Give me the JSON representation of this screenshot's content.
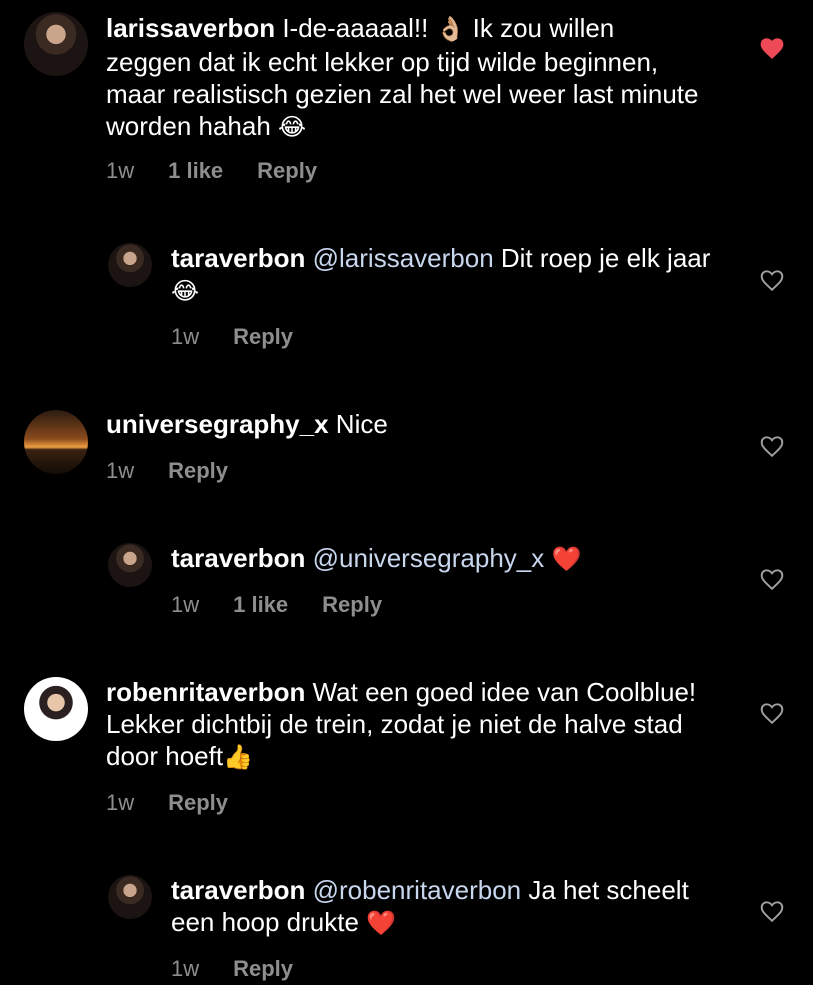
{
  "comments": [
    {
      "username": "larissaverbon",
      "text_before": " I-de-aaaaal!! ",
      "emoji1": "👌🏼",
      "text_after": " Ik zou willen zeggen dat ik echt lekker op tijd wilde beginnen, maar realistisch gezien zal het wel weer last minute worden hahah ",
      "emoji2": "😂",
      "time": "1w",
      "likes": "1 like",
      "reply": "Reply",
      "heart_color": "#ed4956"
    },
    {
      "username": "taraverbon",
      "mention": "@larissaverbon",
      "text": " Dit roep je elk jaar ",
      "emoji": "😂",
      "time": "1w",
      "reply": "Reply"
    },
    {
      "username": "universegraphy_x",
      "text": " Nice",
      "time": "1w",
      "reply": "Reply"
    },
    {
      "username": "taraverbon",
      "mention": "@universegraphy_x",
      "emoji": "❤️",
      "time": "1w",
      "likes": "1 like",
      "reply": "Reply"
    },
    {
      "username": "robenritaverbon",
      "text": " Wat een goed idee van Coolblue! Lekker dichtbij de trein, zodat je niet de halve stad door hoeft",
      "emoji": "👍",
      "time": "1w",
      "reply": "Reply"
    },
    {
      "username": "taraverbon",
      "mention": "@robenritaverbon",
      "text": " Ja het scheelt een hoop drukte ",
      "emoji": "❤️",
      "time": "1w",
      "reply": "Reply"
    }
  ]
}
